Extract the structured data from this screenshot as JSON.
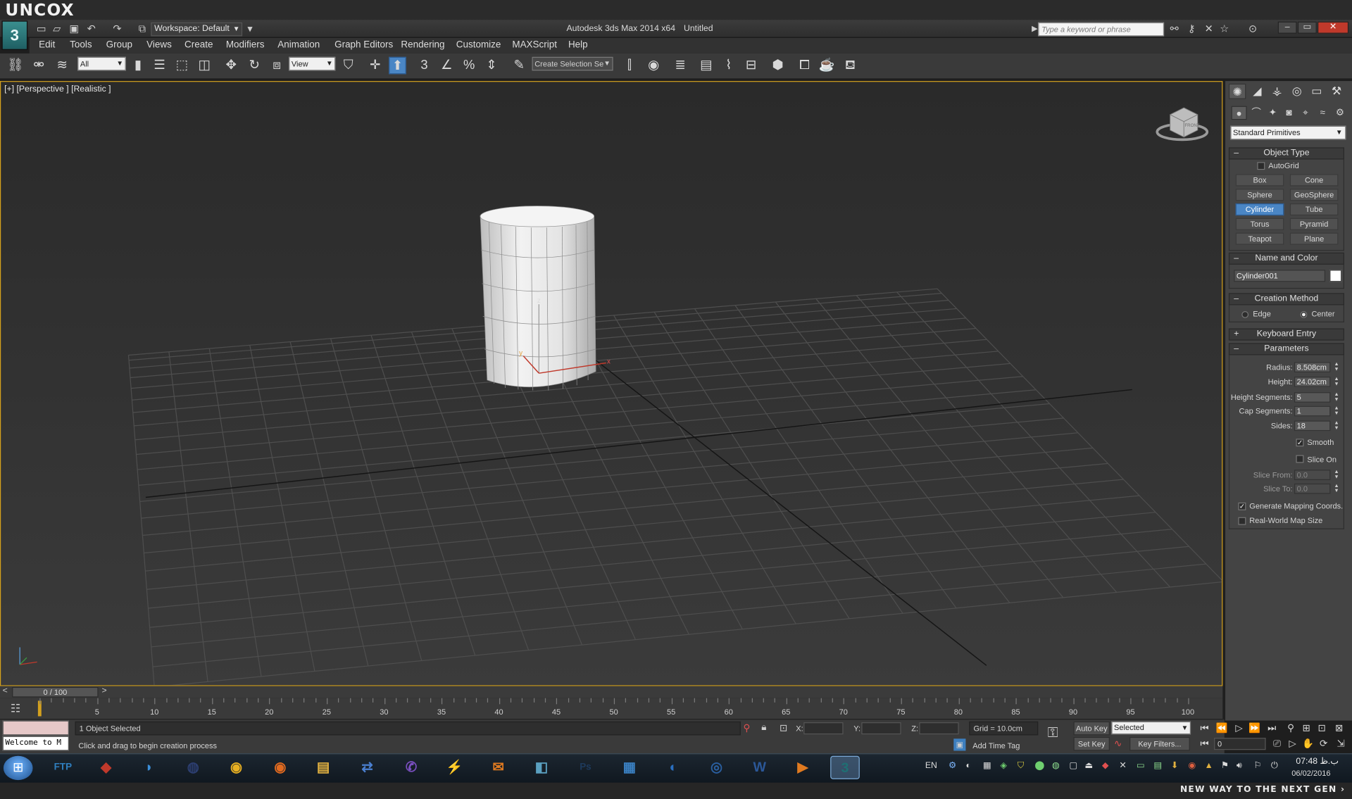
{
  "brand": {
    "logo": "UNCOX",
    "slogan": "NEW WAY TO THE NEXT GEN ›"
  },
  "window": {
    "workspace": "Workspace: Default",
    "app_title": "Autodesk 3ds Max  2014 x64",
    "file_title": "Untitled",
    "search_placeholder": "Type a keyword or phrase"
  },
  "menu": [
    "Edit",
    "Tools",
    "Group",
    "Views",
    "Create",
    "Modifiers",
    "Animation",
    "Graph Editors",
    "Rendering",
    "Customize",
    "MAXScript",
    "Help"
  ],
  "toolbar": {
    "selection_filter": "All",
    "ref_coord": "View",
    "named_selection_placeholder": "Create Selection Se",
    "snap_labels": [
      "3",
      "%"
    ]
  },
  "viewport": {
    "label": "[+] [Perspective ] [Realistic ]",
    "axis_labels": {
      "z": "z",
      "y": "y",
      "x": "x"
    },
    "viewcube_face": "FRONT"
  },
  "command_panel": {
    "category_dropdown": "Standard Primitives",
    "object_type": {
      "title": "Object Type",
      "autogrid": "AutoGrid",
      "buttons": [
        "Box",
        "Cone",
        "Sphere",
        "GeoSphere",
        "Cylinder",
        "Tube",
        "Torus",
        "Pyramid",
        "Teapot",
        "Plane"
      ],
      "selected": "Cylinder"
    },
    "name_and_color": {
      "title": "Name and Color",
      "name": "Cylinder001",
      "color": "#ffffff"
    },
    "creation_method": {
      "title": "Creation Method",
      "options": [
        "Edge",
        "Center"
      ],
      "selected": "Center"
    },
    "keyboard_entry": {
      "title": "Keyboard Entry"
    },
    "parameters": {
      "title": "Parameters",
      "radius_label": "Radius:",
      "radius": "8.508cm",
      "height_label": "Height:",
      "height": "24.02cm",
      "height_segments_label": "Height Segments:",
      "height_segments": "5",
      "cap_segments_label": "Cap Segments:",
      "cap_segments": "1",
      "sides_label": "Sides:",
      "sides": "18",
      "smooth_label": "Smooth",
      "smooth": true,
      "slice_on_label": "Slice On",
      "slice_on": false,
      "slice_from_label": "Slice From:",
      "slice_from": "0.0",
      "slice_to_label": "Slice To:",
      "slice_to": "0.0",
      "gen_mapping_label": "Generate Mapping Coords.",
      "gen_mapping": true,
      "real_world_label": "Real-World Map Size",
      "real_world": false
    }
  },
  "timeline": {
    "slider_text": "0 / 100",
    "ticks": [
      "5",
      "10",
      "15",
      "20",
      "25",
      "30",
      "35",
      "40",
      "45",
      "50",
      "55",
      "60",
      "65",
      "70",
      "75",
      "80",
      "85",
      "90",
      "95",
      "100"
    ]
  },
  "status": {
    "maxscript_listener": "Welcome to M",
    "selection_info": "1 Object Selected",
    "prompt": "Click and drag to begin creation process",
    "x_label": "X:",
    "y_label": "Y:",
    "z_label": "Z:",
    "grid": "Grid = 10.0cm",
    "add_time_tag": "Add Time Tag",
    "auto_key": "Auto Key",
    "set_key": "Set Key",
    "key_mode": "Selected",
    "key_filters": "Key Filters...",
    "current_frame": "0"
  },
  "taskbar": {
    "language": "EN",
    "time": "07:48 ب.ظ",
    "date": "06/02/2016",
    "apps": [
      "FTP",
      "app",
      "web",
      "eclipse",
      "chrome",
      "firefox",
      "explorer",
      "network",
      "viber",
      "tool",
      "outlook",
      "docs",
      "Ps",
      "screen",
      "edge",
      "globe",
      "W",
      "media",
      "3dsmax"
    ]
  },
  "colors": {
    "accent_blue": "#4a86c5",
    "viewport_border": "#d4a11e",
    "x_axis": "#c0392b"
  }
}
